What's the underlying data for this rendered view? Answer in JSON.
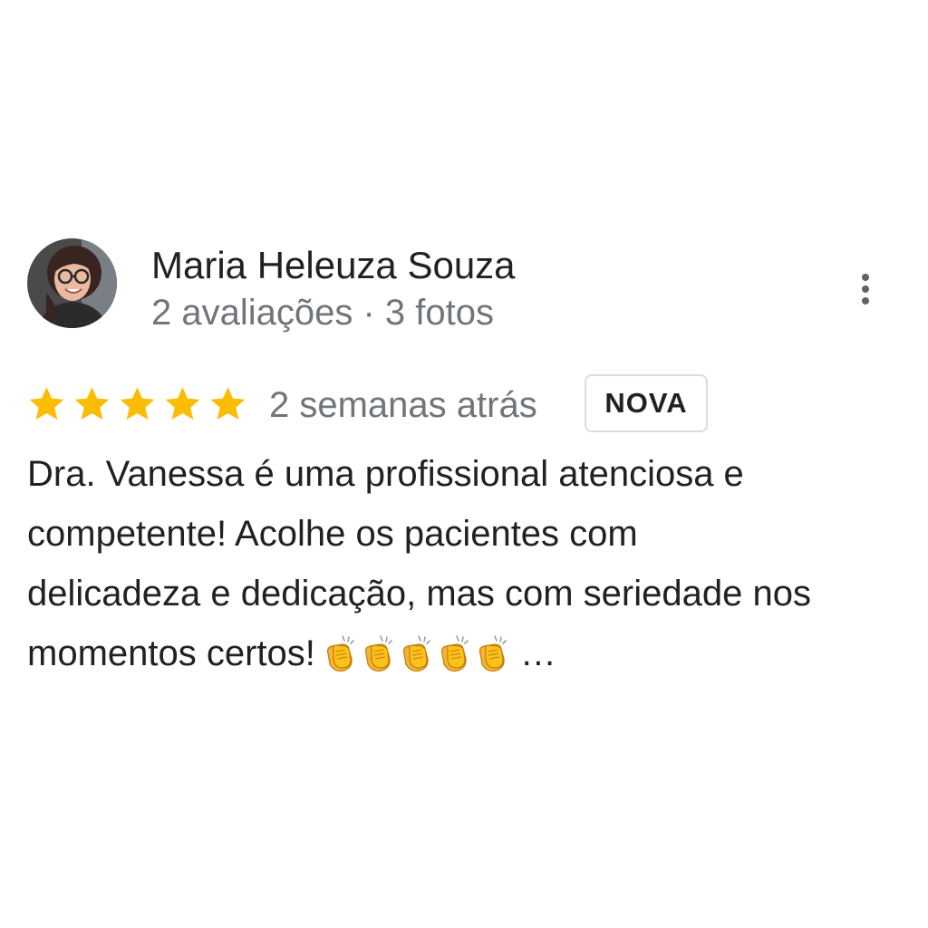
{
  "review": {
    "author": {
      "name": "Maria Heleuza Souza",
      "meta": "2 avaliações · 3 fotos",
      "avatar_icon": "user-photo-avatar"
    },
    "menu_icon": "more-vert-icon",
    "rating": {
      "stars": 5,
      "max": 5,
      "color": "#fbbc04"
    },
    "time_ago": "2 semanas atrás",
    "badge": "NOVA",
    "text_lines": [
      "Dra. Vanessa é uma profissional atenciosa e",
      "competente! Acolhe os pacientes com",
      "delicadeza e dedicação, mas com seriedade  nos",
      "momentos certos!"
    ],
    "emoji": {
      "name": "clapping-hands-icon",
      "count": 5
    },
    "truncation": "…"
  }
}
